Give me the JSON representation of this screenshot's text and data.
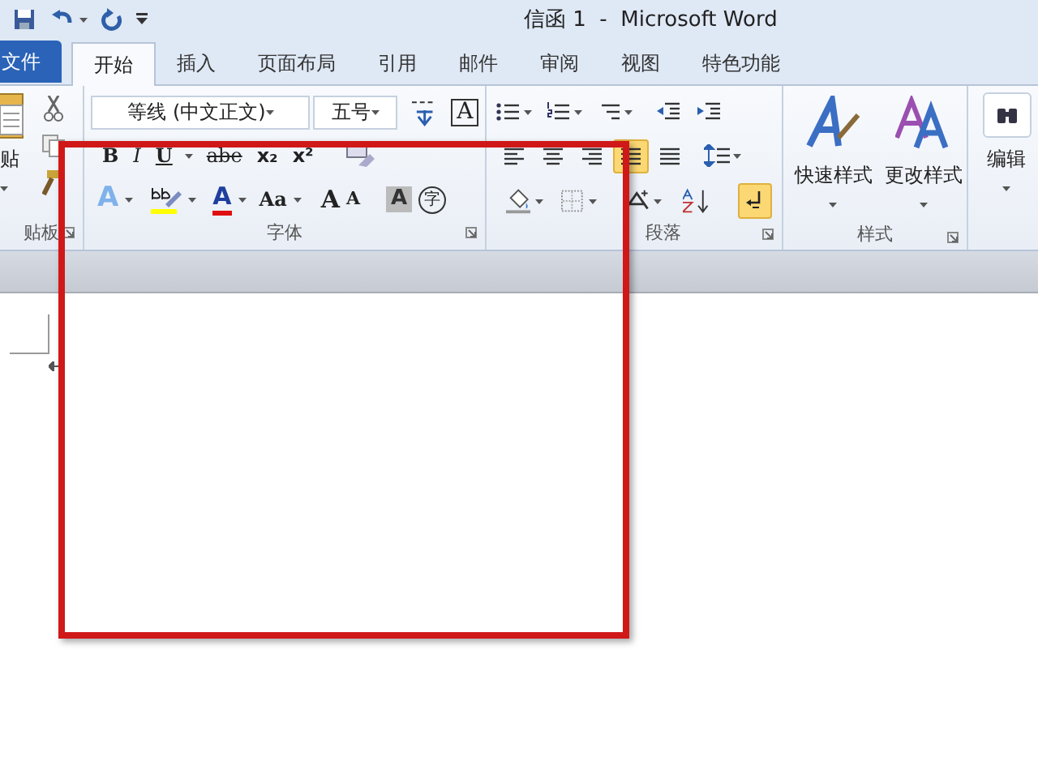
{
  "window": {
    "title": "信函 1  -  Microsoft Word"
  },
  "tabs": [
    {
      "label": "文件",
      "kind": "file",
      "selected": false
    },
    {
      "label": "开始",
      "kind": "tab",
      "selected": true
    },
    {
      "label": "插入",
      "kind": "tab",
      "selected": false
    },
    {
      "label": "页面布局",
      "kind": "tab",
      "selected": false
    },
    {
      "label": "引用",
      "kind": "tab",
      "selected": false
    },
    {
      "label": "邮件",
      "kind": "tab",
      "selected": false
    },
    {
      "label": "审阅",
      "kind": "tab",
      "selected": false
    },
    {
      "label": "视图",
      "kind": "tab",
      "selected": false
    },
    {
      "label": "特色功能",
      "kind": "tab",
      "selected": false
    }
  ],
  "clipboard": {
    "paste_label": "贴",
    "group_label": "贴板"
  },
  "font": {
    "font_name": "等线 (中文正文)",
    "font_size": "五号",
    "phonetic_glyph": "A",
    "format_row": [
      "B",
      "I",
      "U",
      "abe",
      "x₂",
      "x²"
    ],
    "color_row": [
      "A",
      "A",
      "Aa",
      "A",
      "A",
      "A",
      "字"
    ],
    "group_label": "字体"
  },
  "paragraph": {
    "alignment": [
      {
        "selected": false
      },
      {
        "selected": false
      },
      {
        "selected": false
      },
      {
        "selected": true
      },
      {
        "selected": false
      }
    ],
    "show_marks": {
      "on": true
    },
    "group_label": "段落"
  },
  "styles": {
    "items": [
      "快速样式",
      "更改样式"
    ],
    "group_label": "样式"
  },
  "editing": {
    "label": "编辑"
  }
}
